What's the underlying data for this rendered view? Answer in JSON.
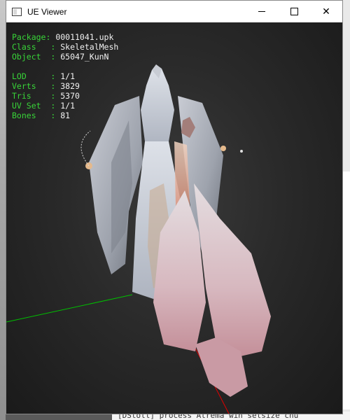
{
  "window": {
    "title": "UE Viewer",
    "buttons": {
      "minimize": "minimize",
      "maximize": "maximize",
      "close": "✕"
    }
  },
  "hud": {
    "package": {
      "key": "Package: ",
      "value": "00011041.upk"
    },
    "class": {
      "key": "Class   : ",
      "value": "SkeletalMesh"
    },
    "object": {
      "key": "Object  : ",
      "value": "65047_KunN"
    },
    "lod": {
      "key": "LOD     : ",
      "value": "1/1"
    },
    "verts": {
      "key": "Verts   : ",
      "value": "3829"
    },
    "tris": {
      "key": "Tris    : ",
      "value": "5370"
    },
    "uvset": {
      "key": "UV Set  : ",
      "value": "1/1"
    },
    "bones": {
      "key": "Bones   : ",
      "value": "81"
    }
  },
  "background": {
    "bottom_text": "[DStoll] process  Atrema win setsize  chu"
  },
  "colors": {
    "hud_key": "#38d438",
    "hud_value": "#f2f2f2",
    "axis_green": "#00c000",
    "axis_red": "#e00000",
    "viewport_bg": "#2a2a2a"
  }
}
